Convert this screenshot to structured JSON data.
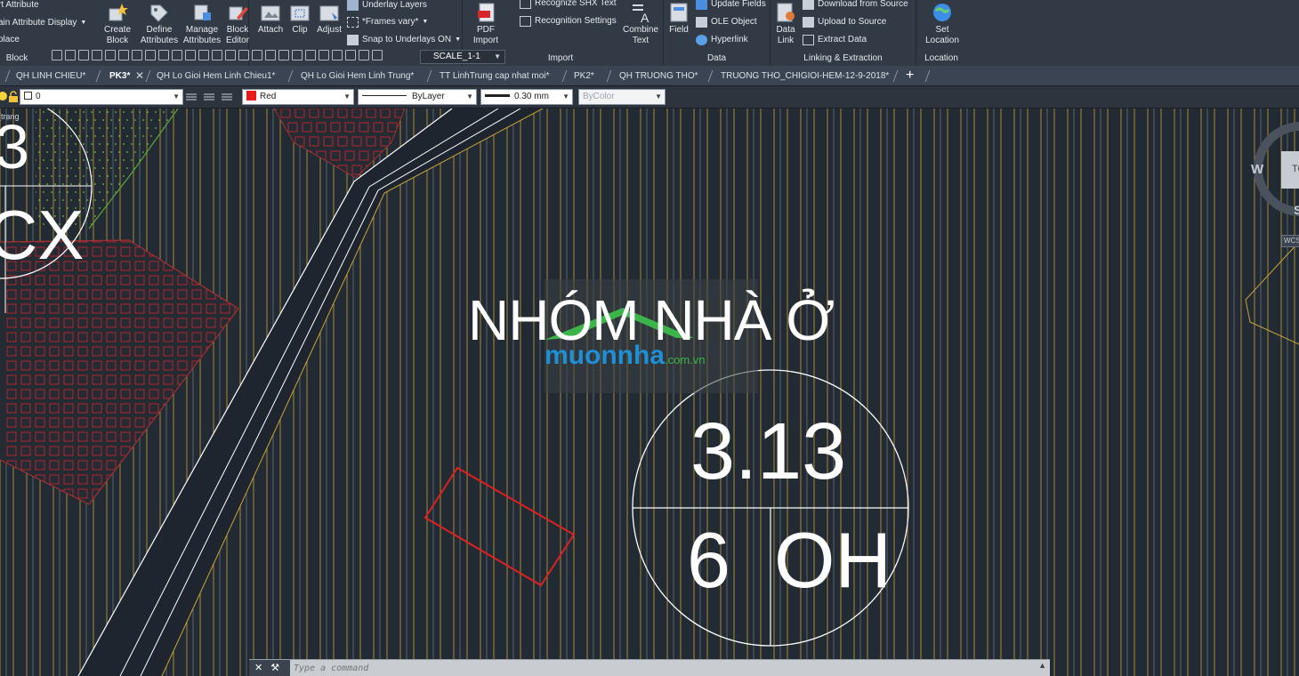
{
  "ribbon": {
    "block_panel": {
      "title": "Block",
      "items": [
        "rt Attribute",
        "ain Attribute Display",
        "place"
      ],
      "create_block": "Create\nBlock",
      "define_attributes": "Define\nAttributes",
      "manage_attributes": "Manage\nAttributes",
      "block_editor": "Block\nEditor"
    },
    "reference_panel": {
      "attach": "Attach",
      "clip": "Clip",
      "adjust": "Adjust",
      "underlay_layers": "Underlay Layers",
      "frames_vary": "*Frames vary*",
      "snap_to_underlays": "Snap to Underlays ON",
      "scale_value": "SCALE_1-1"
    },
    "import_panel": {
      "title": "Import",
      "pdf_import": "PDF\nImport",
      "recognize_shx": "Recognize SHX Text",
      "recognition_settings": "Recognition Settings",
      "combine_text": "Combine\nText"
    },
    "data_panel": {
      "title": "Data",
      "field": "Field",
      "update_fields": "Update Fields",
      "ole_object": "OLE Object",
      "hyperlink": "Hyperlink"
    },
    "linking_panel": {
      "title": "Linking & Extraction",
      "data_link": "Data\nLink",
      "download_from_source": "Download from Source",
      "upload_to_source": "Upload to Source",
      "extract_data": "Extract  Data"
    },
    "location_panel": {
      "title": "Location",
      "set_location": "Set\nLocation"
    }
  },
  "tabs": [
    {
      "label": "QH LINH CHIEU*",
      "active": false
    },
    {
      "label": "PK3*",
      "active": true
    },
    {
      "label": "QH Lo Gioi Hem Linh Chieu1*",
      "active": false
    },
    {
      "label": "QH Lo Gioi Hem Linh Trung*",
      "active": false
    },
    {
      "label": "TT LinhTrung cap nhat moi*",
      "active": false
    },
    {
      "label": "PK2*",
      "active": false
    },
    {
      "label": "QH TRUONG THO*",
      "active": false
    },
    {
      "label": "TRUONG THO_CHIGIOI-HEM-12-9-2018*",
      "active": false
    }
  ],
  "tab_close_glyph": "✕",
  "tab_add_glyph": "+",
  "properties": {
    "layer": "0",
    "color": "Red",
    "color_swatch": "#e81a1a",
    "linetype": "ByLayer",
    "lineweight": "0.30 mm",
    "plotstyle": "ByColor"
  },
  "drawing": {
    "label_top": "3",
    "label_cx": "CX",
    "title": "NHÓM NHÀ Ở",
    "lot_number": "3.13",
    "lot_count": "6",
    "lot_type": "OH",
    "small_label": "(trạng",
    "viewcube_west": "W",
    "viewcube_top": "TO",
    "viewcube_south": "S",
    "wcs_label": "WCS",
    "watermark_main": "muonnha",
    "watermark_domain": ".com.vn"
  },
  "command_line": {
    "placeholder": "Type a command",
    "close_glyph": "✕"
  },
  "colors": {
    "background": "#222a33",
    "hatch_yellow": "#c8a43a",
    "hatch_white": "#c9cdd2",
    "road_fill": "#1e252e",
    "red_outline": "#e02020",
    "pattern_red": "#b3262f",
    "green_dots": "#6fbf3a",
    "watermark_green": "#3bb54a",
    "watermark_blue": "#1f8fd6"
  }
}
